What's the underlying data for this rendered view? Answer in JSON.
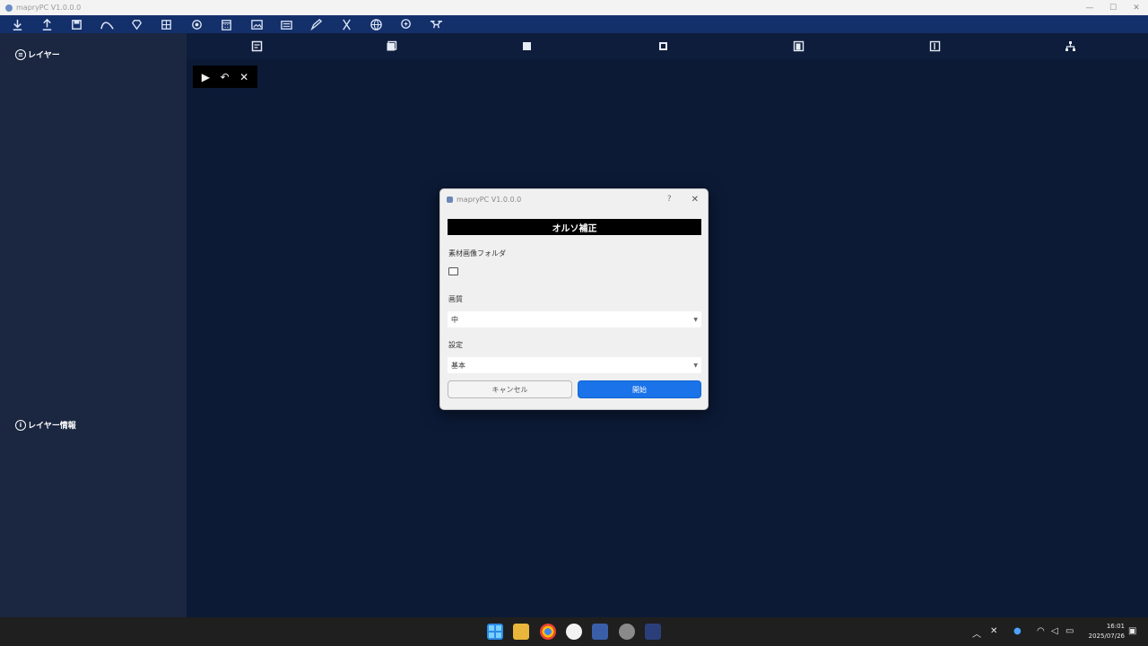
{
  "window": {
    "title": "mapryPC V1.0.0.0",
    "buttons": [
      "—",
      "☐",
      "✕"
    ]
  },
  "toolbar": {
    "icons": [
      "import-icon",
      "export-icon",
      "save-icon",
      "curve-icon",
      "diamond-icon",
      "grid-icon",
      "target-icon",
      "calendar-icon",
      "image-icon",
      "layers-icon",
      "pencil-icon",
      "scissors-icon",
      "globe-icon",
      "zoom-icon",
      "drone-icon"
    ]
  },
  "sidebar": {
    "layers_label": "レイヤー",
    "layer_info_label": "レイヤー情報"
  },
  "toolbar2": {
    "icons": [
      "document-icon",
      "stack-icon",
      "cube-icon",
      "box-icon",
      "copy-icon",
      "file-icon",
      "hierarchy-icon"
    ]
  },
  "mini_controls": {
    "play": "▶",
    "undo": "↶",
    "close": "✕"
  },
  "dialog": {
    "title": "mapryPC V1.0.0.0",
    "help": "?",
    "close": "✕",
    "banner": "オルソ補正",
    "folder_label": "素材画像フォルダ",
    "quality_label": "画質",
    "quality_value": "中",
    "settings_label": "設定",
    "settings_value": "基本",
    "cancel_label": "キャンセル",
    "start_label": "開始",
    "accent": "#1a73e8"
  },
  "taskbar": {
    "apps": [
      "start-icon",
      "explorer-icon",
      "chrome-icon",
      "app-icon",
      "terminal-icon",
      "settings-icon",
      "mapry-icon"
    ],
    "clock_time": "16:01",
    "clock_date": "2025/07/26"
  }
}
